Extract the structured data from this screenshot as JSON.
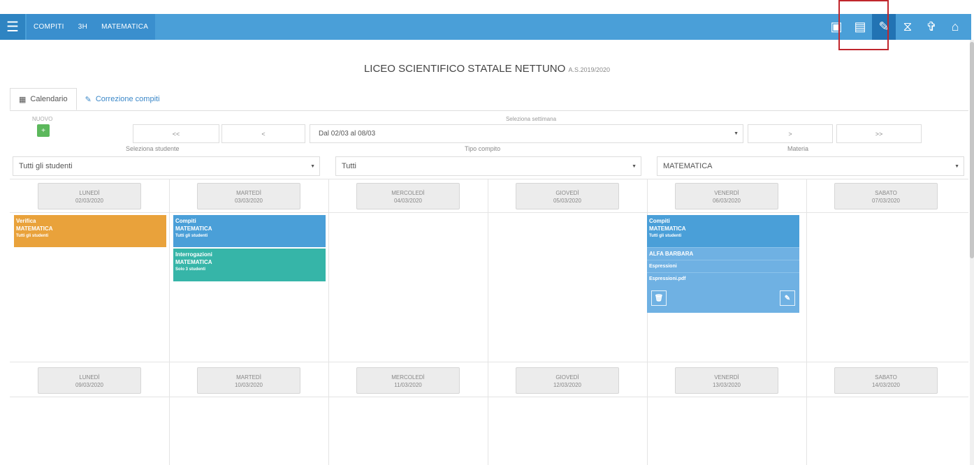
{
  "header": {
    "breadcrumbs": [
      "COMPITI",
      "3H",
      "MATEMATICA"
    ],
    "icons": [
      "book-icon",
      "book-open-icon",
      "book-edit-icon",
      "megaphone-icon",
      "cutlery-icon",
      "home-icon"
    ]
  },
  "school": {
    "name": "LICEO SCIENTIFICO STATALE NETTUNO",
    "year": "A.S.2019/2020"
  },
  "tabs": [
    {
      "label": "Calendario",
      "icon": "calendar-icon"
    },
    {
      "label": "Correzione compiti",
      "icon": "pencil-icon"
    }
  ],
  "toolbar": {
    "nuovo_label": "NUOVO",
    "nuovo_button": "+",
    "week_label": "Seleziona settimana",
    "first": "<<",
    "prev": "<",
    "week_value": "Dal 02/03 al 08/03",
    "next": ">",
    "last": ">>"
  },
  "filters": {
    "student_label": "Seleziona studente",
    "student_value": "Tutti gli studenti",
    "type_label": "Tipo compito",
    "type_value": "Tutti",
    "subject_label": "Materia",
    "subject_value": "MATEMATICA"
  },
  "week1": [
    {
      "day": "LUNEDÌ",
      "date": "02/03/2020"
    },
    {
      "day": "MARTEDÌ",
      "date": "03/03/2020"
    },
    {
      "day": "MERCOLEDÌ",
      "date": "04/03/2020"
    },
    {
      "day": "GIOVEDÌ",
      "date": "05/03/2020"
    },
    {
      "day": "VENERDÌ",
      "date": "06/03/2020"
    },
    {
      "day": "SABATO",
      "date": "07/03/2020"
    }
  ],
  "week2": [
    {
      "day": "LUNEDÌ",
      "date": "09/03/2020"
    },
    {
      "day": "MARTEDÌ",
      "date": "10/03/2020"
    },
    {
      "day": "MERCOLEDÌ",
      "date": "11/03/2020"
    },
    {
      "day": "GIOVEDÌ",
      "date": "12/03/2020"
    },
    {
      "day": "VENERDÌ",
      "date": "13/03/2020"
    },
    {
      "day": "SABATO",
      "date": "14/03/2020"
    }
  ],
  "events": {
    "verifica": {
      "type": "Verifica",
      "subject": "MATEMATICA",
      "who": "Tutti gli studenti",
      "color": "#e9a23b"
    },
    "compiti_mar": {
      "type": "Compiti",
      "subject": "MATEMATICA",
      "who": "Tutti gli studenti",
      "color": "#4a9fd8"
    },
    "interrogazioni": {
      "type": "Interrogazioni",
      "subject": "MATEMATICA",
      "who": "Solo 3 studenti",
      "color": "#36b5a8"
    },
    "compiti_ven": {
      "type": "Compiti",
      "subject": "MATEMATICA",
      "who": "Tutti gli studenti",
      "student": "ALFA BARBARA",
      "topic": "Espressioni",
      "file": "Espressioni.pdf",
      "color": "#6fb1e3"
    }
  },
  "colors": {
    "topbar": "#4a9fd8",
    "highlight": "#c0262c",
    "nuovo": "#5cb85c"
  }
}
